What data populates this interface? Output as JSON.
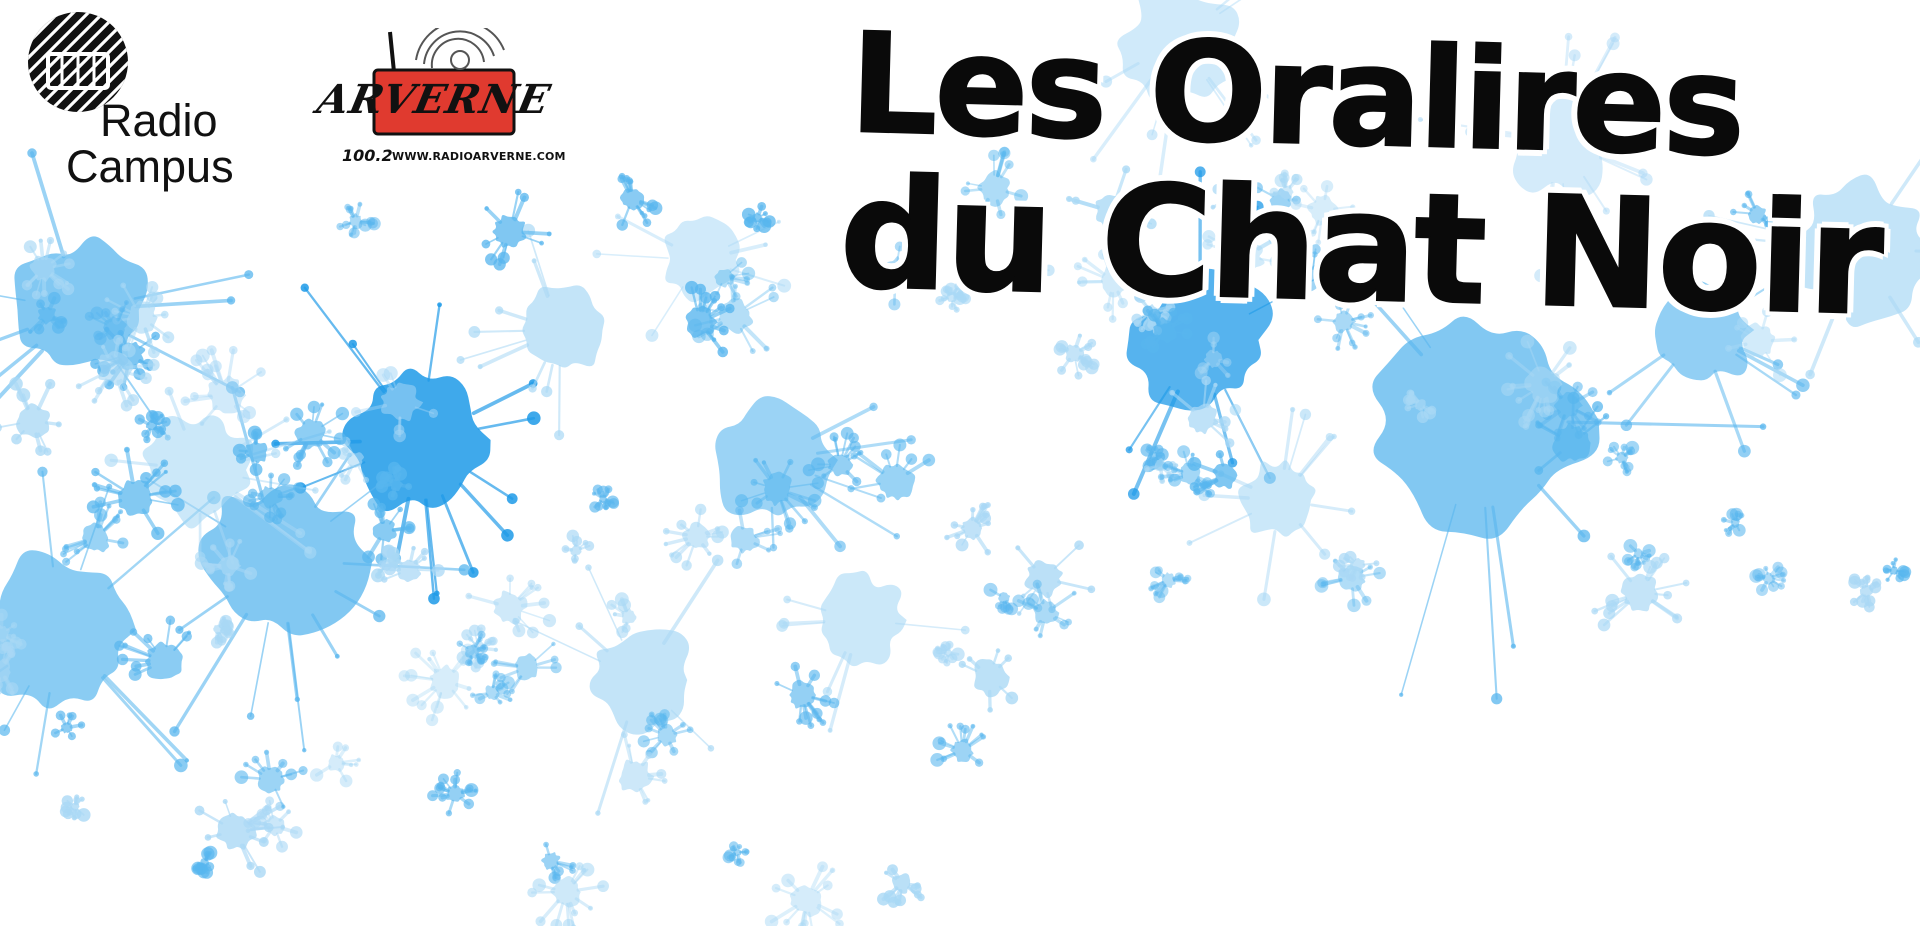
{
  "logos": {
    "radio_campus": {
      "line1": "Radio",
      "line2": "Campus"
    },
    "radio_arverne": {
      "brand": "ARVERNE",
      "frequency": "100.2",
      "url": "WWW.RADIOARVERNE.COM",
      "accent_color": "#e03a2f"
    }
  },
  "title": {
    "line1": "Les Oralires",
    "line2": "du Chat Noir"
  },
  "colors": {
    "splatter_light": "#a9d8f5",
    "splatter_mid": "#58b6ee",
    "splatter_dark": "#1d9ae8",
    "text": "#0a0a0a"
  }
}
